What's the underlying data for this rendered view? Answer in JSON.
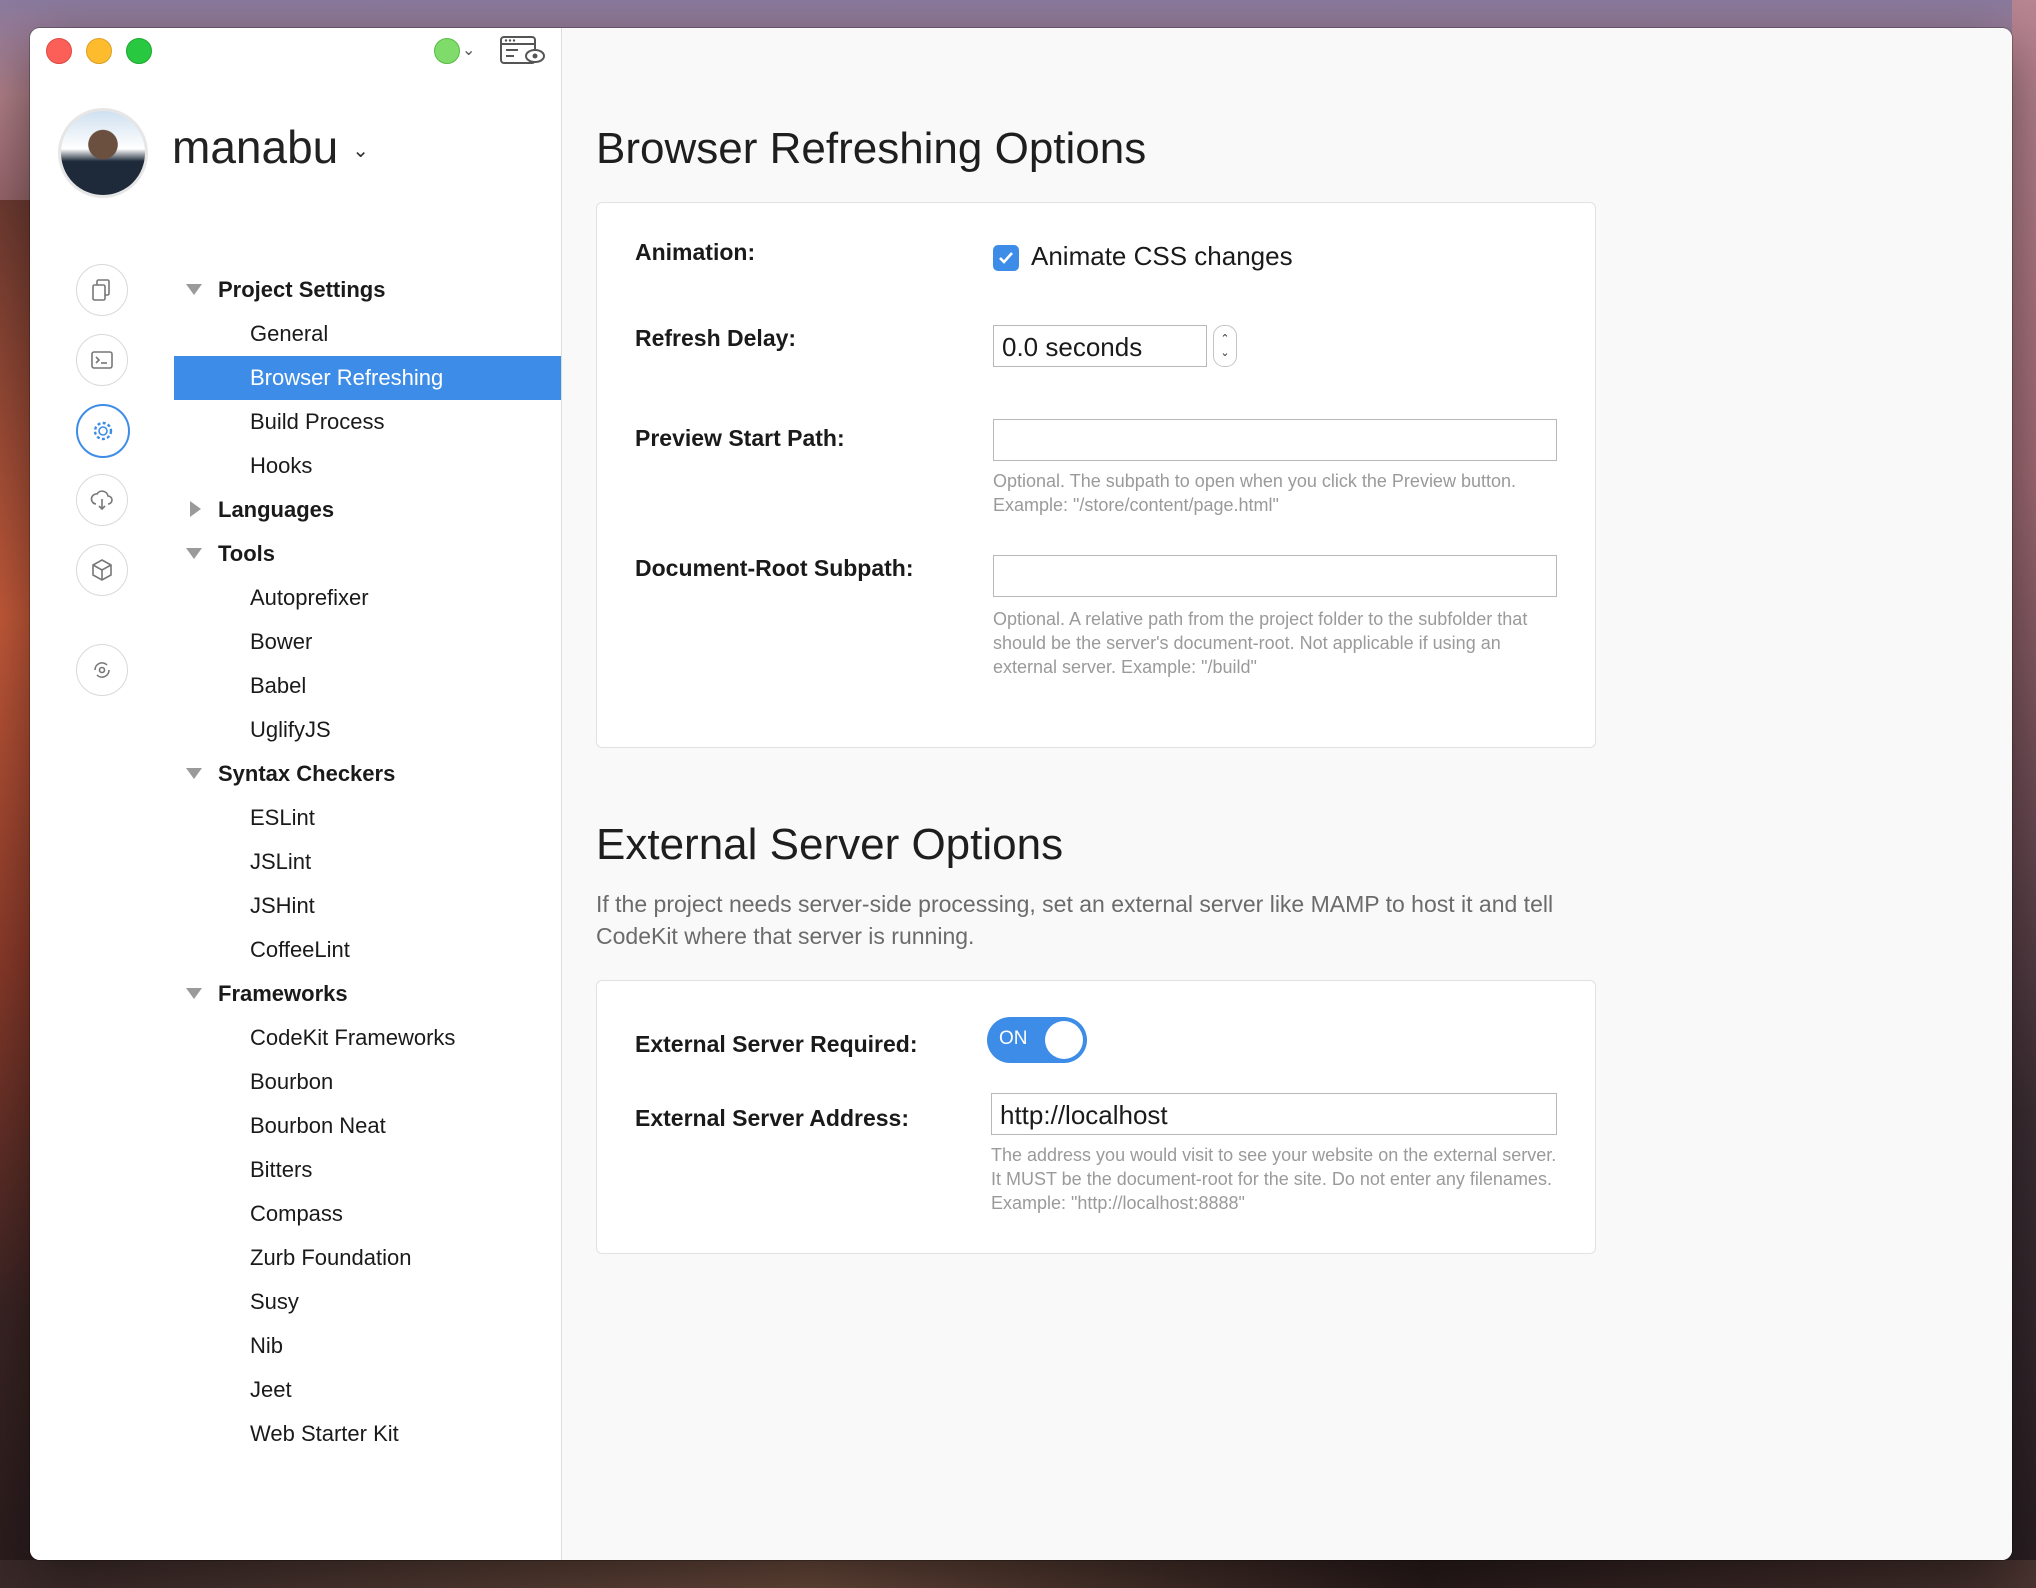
{
  "app": {
    "user_name": "manabu"
  },
  "sidebar": {
    "tree": [
      {
        "label": "Project Settings",
        "kind": "section",
        "expanded": true
      },
      {
        "label": "General",
        "kind": "child"
      },
      {
        "label": "Browser Refreshing",
        "kind": "child",
        "selected": true
      },
      {
        "label": "Build Process",
        "kind": "child"
      },
      {
        "label": "Hooks",
        "kind": "child"
      },
      {
        "label": "Languages",
        "kind": "section",
        "expanded": false
      },
      {
        "label": "Tools",
        "kind": "section",
        "expanded": true
      },
      {
        "label": "Autoprefixer",
        "kind": "child"
      },
      {
        "label": "Bower",
        "kind": "child"
      },
      {
        "label": "Babel",
        "kind": "child"
      },
      {
        "label": "UglifyJS",
        "kind": "child"
      },
      {
        "label": "Syntax Checkers",
        "kind": "section",
        "expanded": true
      },
      {
        "label": "ESLint",
        "kind": "child"
      },
      {
        "label": "JSLint",
        "kind": "child"
      },
      {
        "label": "JSHint",
        "kind": "child"
      },
      {
        "label": "CoffeeLint",
        "kind": "child"
      },
      {
        "label": "Frameworks",
        "kind": "section",
        "expanded": true
      },
      {
        "label": "CodeKit Frameworks",
        "kind": "child"
      },
      {
        "label": "Bourbon",
        "kind": "child"
      },
      {
        "label": "Bourbon Neat",
        "kind": "child"
      },
      {
        "label": "Bitters",
        "kind": "child"
      },
      {
        "label": "Compass",
        "kind": "child"
      },
      {
        "label": "Zurb Foundation",
        "kind": "child"
      },
      {
        "label": "Susy",
        "kind": "child"
      },
      {
        "label": "Nib",
        "kind": "child"
      },
      {
        "label": "Jeet",
        "kind": "child"
      },
      {
        "label": "Web Starter Kit",
        "kind": "child"
      }
    ],
    "icons": [
      "files-icon",
      "terminal-icon",
      "gear-icon",
      "cloud-download-icon",
      "package-box-icon",
      "sync-icon"
    ],
    "active_icon": "gear-icon"
  },
  "browser_refreshing": {
    "title": "Browser Refreshing Options",
    "animation_label": "Animation:",
    "animate_css_label": "Animate CSS changes",
    "animate_css_checked": true,
    "refresh_delay_label": "Refresh Delay:",
    "refresh_delay_value": "0.0 seconds",
    "preview_start_path_label": "Preview Start Path:",
    "preview_start_path_value": "",
    "preview_start_path_help": "Optional. The subpath to open when you click the Preview button. Example: \"/store/content/page.html\"",
    "document_root_label": "Document-Root Subpath:",
    "document_root_value": "",
    "document_root_help": "Optional. A relative path from the project folder to the subfolder that should be the server's document-root. Not applicable if using an external server. Example: \"/build\""
  },
  "external_server": {
    "title": "External Server Options",
    "description": "If the project needs server-side processing, set an external server like MAMP to host it and tell CodeKit where that server is running.",
    "required_label": "External Server Required:",
    "required_toggle_text": "ON",
    "required_on": true,
    "address_label": "External Server Address:",
    "address_value": "http://localhost",
    "address_help": "The address you would visit to see your website on the external server. It MUST be the document-root for the site. Do not enter any filenames. Example: \"http://localhost:8888\""
  },
  "colors": {
    "accent": "#3d8de8",
    "status_green": "#7fdc6a"
  }
}
